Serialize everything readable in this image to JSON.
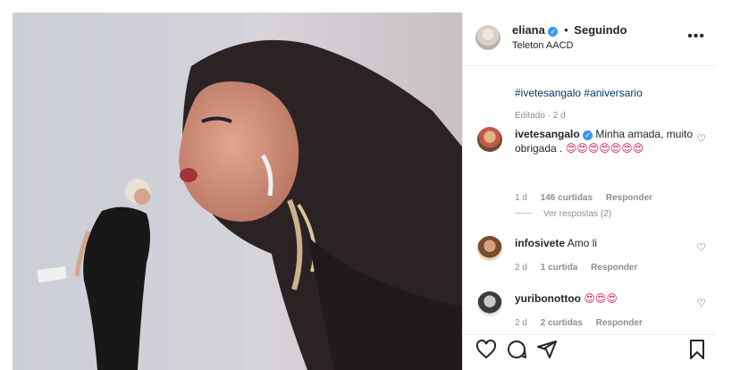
{
  "post": {
    "author": "eliana",
    "separator": "•",
    "follow_status": "Seguindo",
    "location": "Teleton AACD",
    "more_label": "•••",
    "hashtags": "#ivetesangalo #aniversario",
    "edited": "Editado · 2 d",
    "view_replies": "Ver respostas (2)"
  },
  "comments": [
    {
      "user": "ivetesangalo",
      "verified": true,
      "text": "Minha amada, muito obrigada .",
      "emojis": "😍😍😍😍😍😍😍",
      "time": "1 d",
      "likes": "146 curtidas",
      "reply": "Responder"
    },
    {
      "user": "infosivete",
      "verified": false,
      "text": "Amo li",
      "emojis": "",
      "time": "2 d",
      "likes": "1 curtida",
      "reply": "Responder"
    },
    {
      "user": "yuribonottoo",
      "verified": false,
      "text": "",
      "emojis": "😍😍😍",
      "time": "2 d",
      "likes": "2 curtidas",
      "reply": "Responder"
    }
  ],
  "icons": {
    "heart": "heart-icon",
    "comment": "comment-icon",
    "share": "share-icon",
    "save": "bookmark-icon",
    "verified": "verified-badge-icon",
    "more": "more-options-icon"
  },
  "colors": {
    "link": "#00376b",
    "verified": "#3897f0",
    "muted": "#8e8e8e",
    "text": "#262626"
  }
}
